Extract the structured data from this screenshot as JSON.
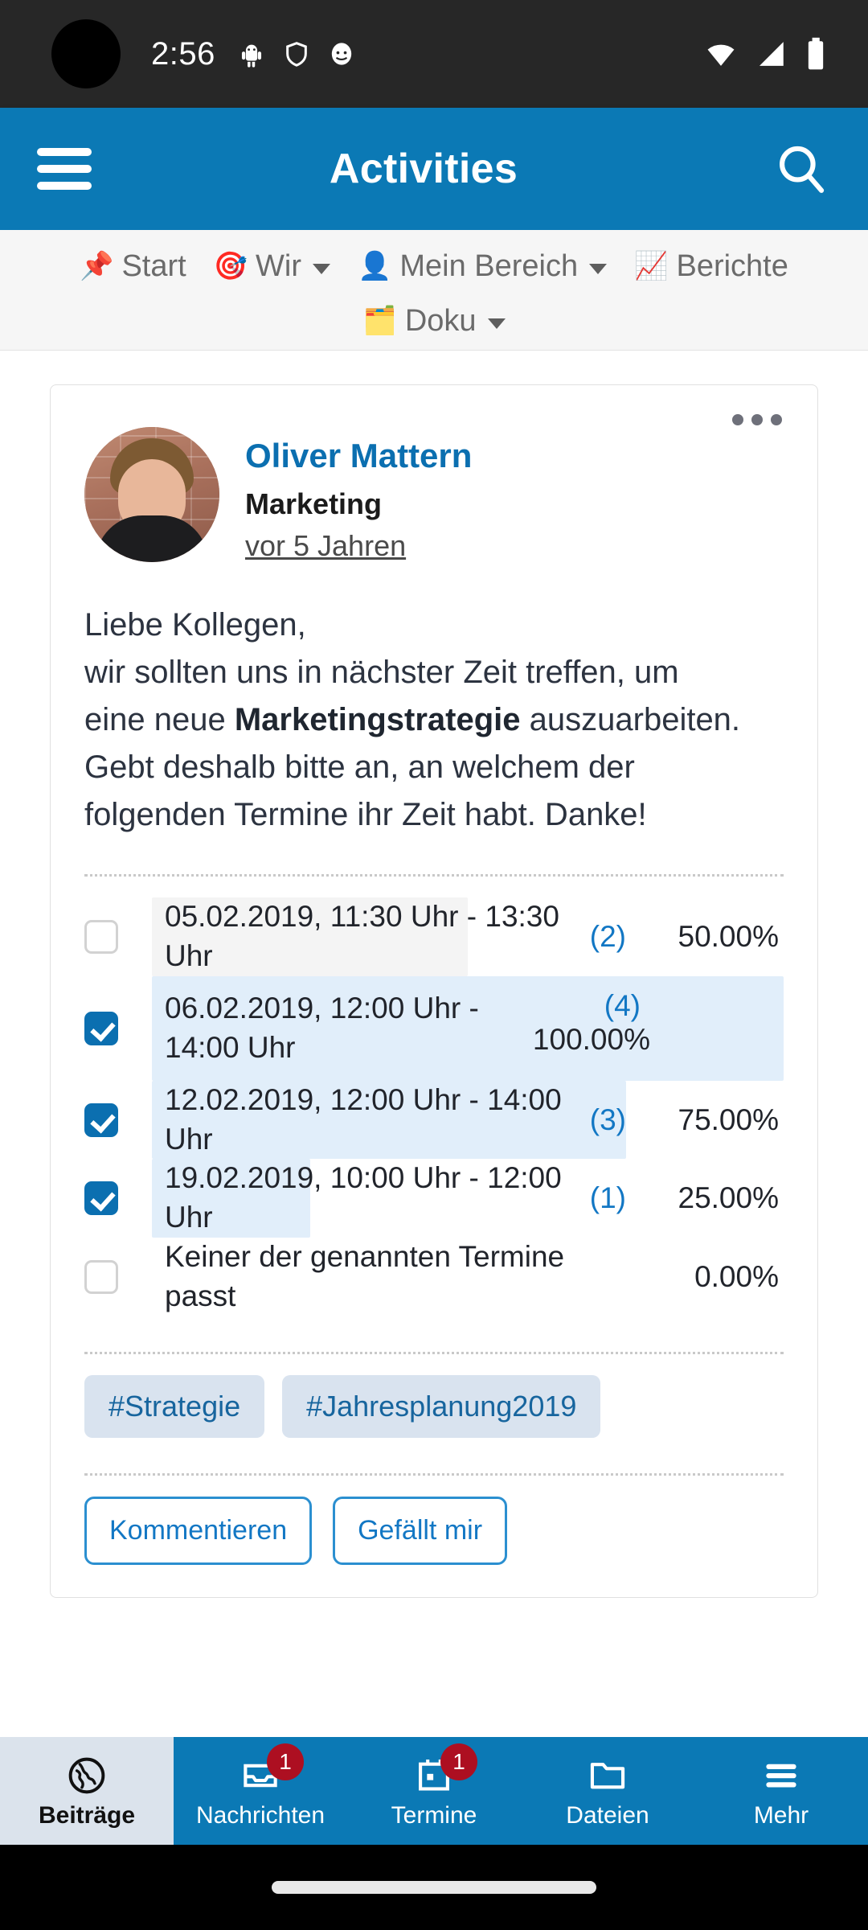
{
  "status_bar": {
    "time": "2:56",
    "left_icons": [
      "android-robot-icon",
      "shield-icon",
      "mask-icon"
    ],
    "right_icons": [
      "wifi-icon",
      "cellular-signal-icon",
      "battery-icon"
    ]
  },
  "app_bar": {
    "menu_icon": "hamburger-menu-icon",
    "title": "Activities",
    "search_icon": "search-icon"
  },
  "sub_nav": {
    "items": [
      {
        "emoji": "📌",
        "label": "Start",
        "icon": "pushpin-icon",
        "has_caret": false
      },
      {
        "emoji": "🎯",
        "label": "Wir",
        "icon": "target-icon",
        "has_caret": true
      },
      {
        "emoji": "👤",
        "label": "Mein Bereich",
        "icon": "person-icon",
        "has_caret": true
      },
      {
        "emoji": "📈",
        "label": "Berichte",
        "icon": "chart-increasing-icon",
        "has_caret": false
      },
      {
        "emoji": "🗂️",
        "label": "Doku",
        "icon": "card-index-dividers-icon",
        "has_caret": true
      }
    ]
  },
  "post": {
    "overflow_icon": "more-options-icon",
    "author": "Oliver Mattern",
    "role": "Marketing",
    "time": "vor 5 Jahren",
    "avatar_icon": "user-avatar-photo",
    "text_lines": [
      "Liebe Kollegen,",
      "wir sollten uns in nächster Zeit treffen, um"
    ],
    "text_part_before_bold": "eine neue ",
    "text_bold": "Marketingstrategie",
    "text_after_bold": "auszuarbeiten. Gebt deshalb bitte an, an welchem der folgenden Termine ihr Zeit habt. Danke!"
  },
  "poll": {
    "options": [
      {
        "label": "05.02.2019, 11:30 Uhr - 13:30 Uhr",
        "count": "(2)",
        "percent_label": "50.00%",
        "percent": 50,
        "checked": false,
        "bar_style": "gray",
        "wrapped": false
      },
      {
        "label": "06.02.2019, 12:00 Uhr - 14:00 Uhr",
        "count": "(4)",
        "percent_label": "100.00%",
        "percent": 100,
        "checked": true,
        "bar_style": "blue",
        "wrapped": true
      },
      {
        "label": "12.02.2019, 12:00 Uhr - 14:00 Uhr",
        "count": "(3)",
        "percent_label": "75.00%",
        "percent": 75,
        "checked": true,
        "bar_style": "blue",
        "wrapped": false
      },
      {
        "label": "19.02.2019, 10:00 Uhr - 12:00 Uhr",
        "count": "(1)",
        "percent_label": "25.00%",
        "percent": 25,
        "checked": true,
        "bar_style": "blue",
        "wrapped": false
      },
      {
        "label": "Keiner der genannten Termine passt",
        "count": "",
        "percent_label": "0.00%",
        "percent": 0,
        "checked": false,
        "bar_style": "none",
        "wrapped": false
      }
    ]
  },
  "tags": [
    "#Strategie",
    "#Jahresplanung2019"
  ],
  "actions": [
    "Kommentieren",
    "Gefällt mir"
  ],
  "bottom_nav": {
    "items": [
      {
        "label": "Beiträge",
        "icon": "globe-icon",
        "active": true,
        "badge": ""
      },
      {
        "label": "Nachrichten",
        "icon": "inbox-icon",
        "active": false,
        "badge": "1"
      },
      {
        "label": "Termine",
        "icon": "calendar-icon",
        "active": false,
        "badge": "1"
      },
      {
        "label": "Dateien",
        "icon": "folder-icon",
        "active": false,
        "badge": ""
      },
      {
        "label": "Mehr",
        "icon": "hamburger-menu-icon",
        "active": false,
        "badge": ""
      }
    ]
  },
  "colors": {
    "brand_blue": "#0b79b5",
    "link_blue": "#0b6fb0",
    "poll_blue_bar": "#e1eefa",
    "poll_gray_bar": "#f4f4f4",
    "badge_red": "#ad0f21",
    "tag_bg": "#d9e3ef"
  }
}
